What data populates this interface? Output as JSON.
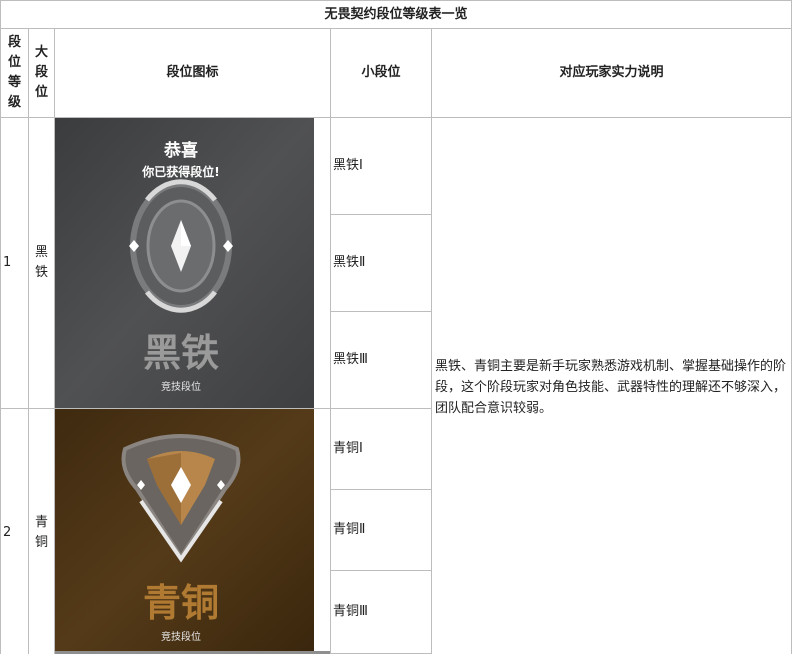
{
  "table": {
    "title": "无畏契约段位等级表一览",
    "headers": {
      "level": "段位等级",
      "major": "大段位",
      "icon": "段位图标",
      "minor": "小段位",
      "desc": "对应玩家实力说明"
    },
    "rows": [
      {
        "level": "1",
        "major": "黑铁",
        "image": {
          "congrats": "恭喜",
          "got": "你已获得段位!",
          "rank_name": "黑铁",
          "caption": "竞技段位"
        },
        "minors": [
          "黑铁Ⅰ",
          "黑铁Ⅱ",
          "黑铁Ⅲ"
        ]
      },
      {
        "level": "2",
        "major": "青铜",
        "image": {
          "rank_name": "青铜",
          "caption": "竞技段位"
        },
        "minors": [
          "青铜Ⅰ",
          "青铜Ⅱ",
          "青铜Ⅲ"
        ]
      }
    ],
    "description": "黑铁、青铜主要是新手玩家熟悉游戏机制、掌握基础操作的阶段，这个阶段玩家对角色技能、武器特性的理解还不够深入，团队配合意识较弱。"
  },
  "colors": {
    "iron_bg": "#4a4b4d",
    "bronze_bg": "#4a3214",
    "bronze_text": "#b07a32",
    "iron_text": "#9a9a9a",
    "border": "#bdbdbd"
  }
}
